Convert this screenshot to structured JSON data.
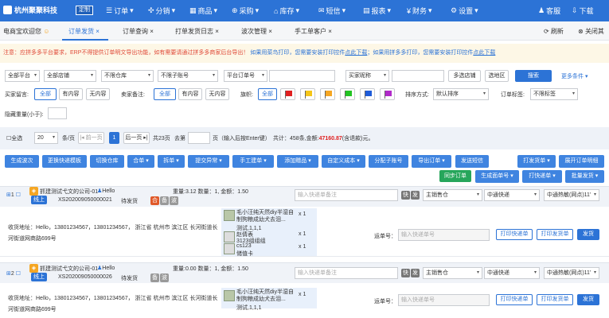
{
  "topnav": {
    "company": "杭州聚聚科技",
    "badge": "定制",
    "items": [
      "订单",
      "分销",
      "商品",
      "采购",
      "库存",
      "短信",
      "报表",
      "财务",
      "设置"
    ],
    "right": [
      "客服",
      "下载"
    ]
  },
  "tabs": {
    "home": "电商宝欢迎您",
    "items": [
      "订单发货",
      "订单查询",
      "打单发货日志",
      "波次管理",
      "手工单客户"
    ],
    "refresh": "刷新",
    "close_other": "关闭其"
  },
  "notice": {
    "red": "注意：应拼多多平台要求，ERP不得提供订单明文导出功能，如有需要请通过拼多多商家后台导出！",
    "blue1": "如果用菜鸟打印，您需要安装打印控件",
    "link1": "点此下载",
    "blue2": "；如果用拼多多打印，您需要安装打印控件",
    "link2": "点此下载"
  },
  "filters": {
    "row1": {
      "platform": "全部平台",
      "shop": "全部店铺",
      "warehouse": "不限仓库",
      "account": "不限子账号",
      "order_no": "平台订单号",
      "nickname": "买家昵称",
      "multi_shop": "多选店铺",
      "select_area": "选地区",
      "search": "搜索",
      "more": "更多条件"
    },
    "row2": {
      "buyer_msg": "买家留言:",
      "opt_all": "全部",
      "opt_has": "有内容",
      "opt_none": "无内容",
      "seller_note": "卖家备注:",
      "flag_label": "旗帜:",
      "sort_label": "排序方式:",
      "sort_value": "默认排序",
      "tag_label": "订单标签:",
      "tag_value": "不限标签"
    },
    "row3": {
      "weight_label": "隐藏重量(小于):"
    }
  },
  "pager": {
    "select_all": "全选",
    "page_size": "20",
    "per_page": "条/页",
    "prev": "前一页",
    "current": "1",
    "next": "后一页",
    "total_pages_text": "共23页",
    "goto": "去第",
    "hint": "页（输入后按Enter键）",
    "summary_prefix": "共计：",
    "count": "458",
    "count_suffix": "条,",
    "amount_prefix": "金额:",
    "amount": "47160.87",
    "amount_suffix": "(含退款)元。"
  },
  "actions": {
    "row1": [
      "生成波次",
      "更换快递模板",
      "切换仓库",
      "合单",
      "拆单",
      "提交异常",
      "手工建单",
      "添加赠品",
      "自定义成本",
      "分配子账号",
      "导出订单",
      "发送短信",
      "打发货单",
      "展开订单明细"
    ],
    "row2": [
      "同步订单",
      "生成面单号",
      "打快递单",
      "批量发货"
    ]
  },
  "orders": [
    {
      "index": "1",
      "shop": "抓建测试弋文的公司-01",
      "buyer": "Hello",
      "status_tag": "线上",
      "order_no": "XS202009050000021",
      "state": "待发货",
      "weight_text": "重量:3.12 数量：1, 金额：1.50",
      "express_note_ph": "输入快递单备注",
      "warehouse": "主销售仓",
      "express": "中通快递",
      "express_site": "中通热敏(网点)11'",
      "address": "收货地址：Hello，13801234567，13801234567， 浙江省 杭州市 滨江区 长河街道长河街道网商路699号",
      "items": [
        {
          "name": "毛小汪纯天然diy半湿自制狗粮成幼犬去泪...",
          "spec": "测试,1,1,1",
          "qty": "x 1"
        },
        {
          "name": "赵倩表",
          "spec": "3123组组组",
          "qty": "x 1"
        },
        {
          "name": "cs123",
          "spec": "储值卡",
          "qty": "x 1"
        }
      ],
      "waybill_label": "运单号：",
      "waybill_ph": "输入快递单号",
      "btn_print_express": "打印快递单",
      "btn_print_delivery": "打印发货单",
      "btn_ship": "发货"
    },
    {
      "index": "2",
      "shop": "抓建测试弋文的公司-01",
      "buyer": "Hello",
      "status_tag": "线上",
      "order_no": "XS202009050000026",
      "state": "待发货",
      "weight_text": "重量:0.00 数量：1, 金额：1.50",
      "express_note_ph": "输入快递单备注",
      "warehouse": "主销售仓",
      "express": "中通快递",
      "express_site": "中通热敏(网点)11'",
      "address": "收货地址：Hello，13801234567，13801234567， 浙江省 杭州市 滨江区 长河街道长河街道网商路699号",
      "items": [
        {
          "name": "毛小汪纯天然diy半湿自制狗粮成幼犬去泪...",
          "spec": "测试,1,1,1",
          "qty": "x 1"
        }
      ],
      "waybill_label": "运单号：",
      "waybill_ph": "输入快递单号",
      "btn_print_express": "打印快递单",
      "btn_print_delivery": "打印发货单",
      "btn_ship": "发货"
    }
  ]
}
